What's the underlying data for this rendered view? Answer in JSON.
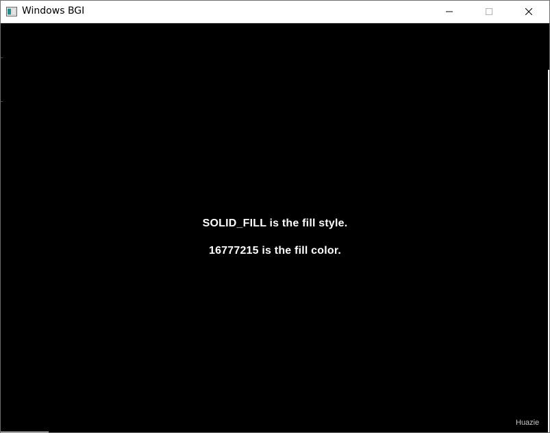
{
  "window": {
    "title": "Windows BGI",
    "icons": {
      "app": "window-app-icon",
      "minimize": "minimize-icon",
      "maximize": "maximize-icon",
      "close": "close-icon"
    }
  },
  "canvas": {
    "background": "#000000",
    "text_color": "#ffffff",
    "lines": [
      "SOLID_FILL is the fill style.",
      "16777215 is the fill color."
    ]
  },
  "watermark": "Huazie"
}
